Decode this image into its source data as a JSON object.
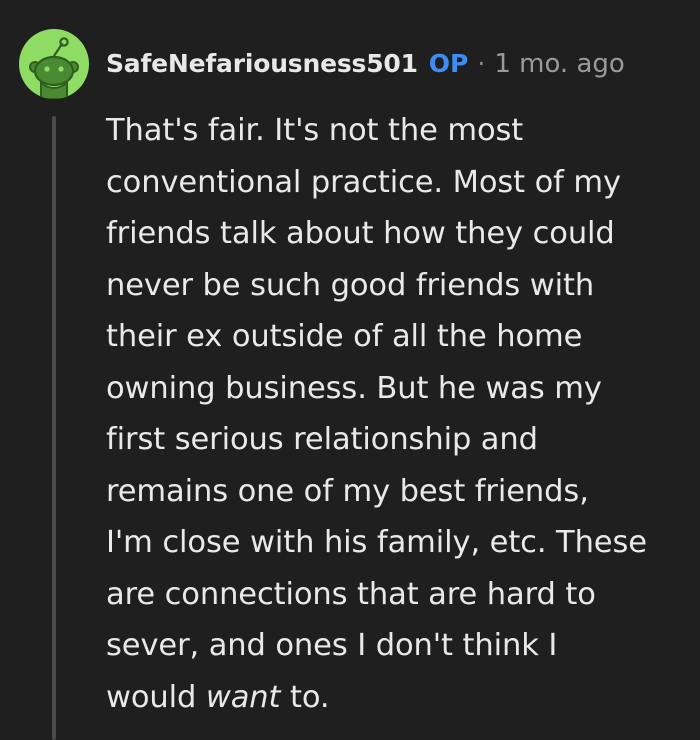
{
  "comment": {
    "username": "SafeNefariousness501",
    "op_badge": "OP",
    "separator": "·",
    "timestamp": "1 mo. ago",
    "avatar_icon": "reddit-snoo-avatar-icon",
    "avatar_color": "#8fdc64",
    "op_color": "#3d8df5",
    "body_lines": [
      "That's fair. It's not the most",
      "conventional practice. Most of my",
      "friends talk about how they could",
      "never be such good friends with",
      "their ex outside of all the home",
      "owning business. But he was my",
      "first serious relationship and",
      "remains one of my best friends,",
      "I'm close with his family, etc. These",
      "are connections that are hard to",
      "sever, and ones I don't think I"
    ],
    "last_line_start": "would ",
    "last_line_emphasis": "want",
    "last_line_end": " to."
  }
}
